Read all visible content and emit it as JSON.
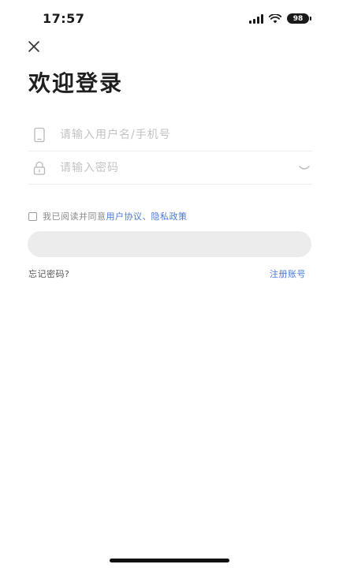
{
  "status_bar": {
    "time": "17:57",
    "battery": "98"
  },
  "header": {
    "close_icon": "close-icon",
    "title": "欢迎登录"
  },
  "form": {
    "username": {
      "placeholder": "请输入用户名/手机号",
      "value": "",
      "icon": "phone-icon"
    },
    "password": {
      "placeholder": "请输入密码",
      "value": "",
      "icon": "lock-icon",
      "toggle_icon": "eye-closed-icon"
    },
    "agreement": {
      "checked": false,
      "prefix": "我已阅读并同意",
      "user_agreement": "用户协议",
      "separator": "、",
      "privacy_policy": "隐私政策"
    },
    "login_label": ""
  },
  "footer_links": {
    "forgot_password": "忘记密码?",
    "register": "注册账号"
  },
  "colors": {
    "accent": "#4a78d8",
    "button_disabled": "#ececec",
    "placeholder": "#c3c3c3"
  }
}
